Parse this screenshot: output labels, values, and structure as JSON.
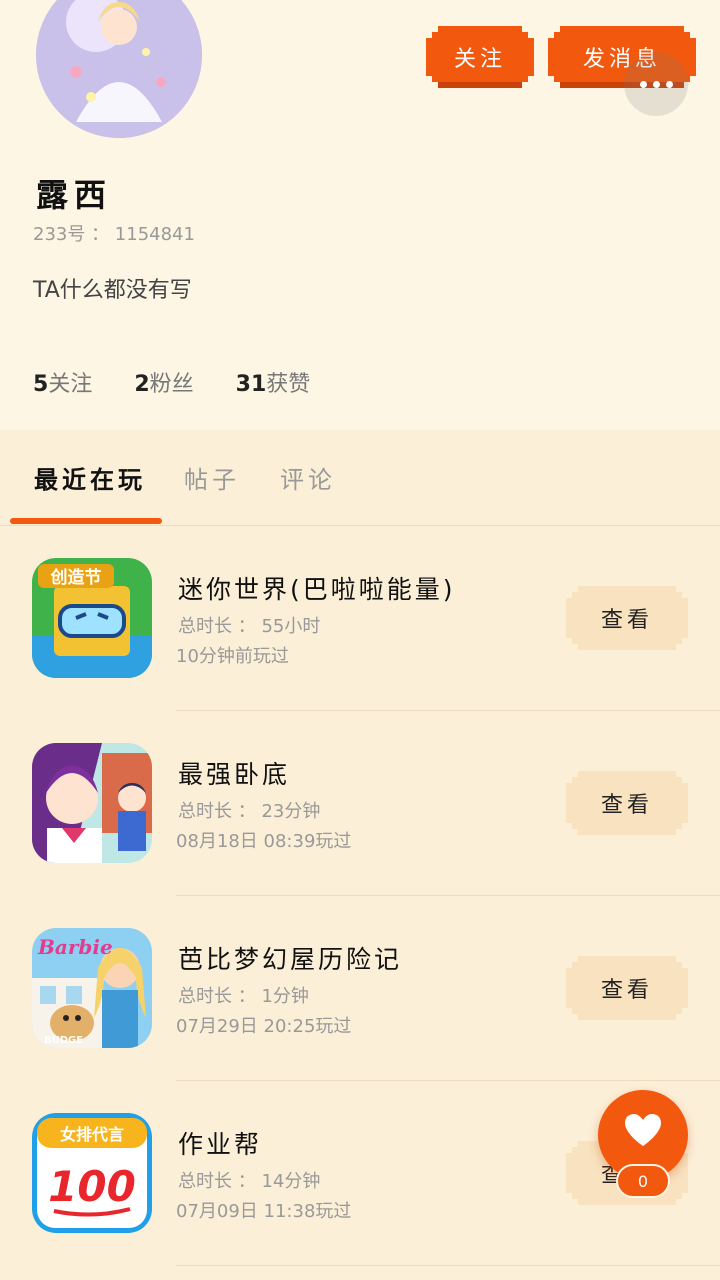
{
  "profile": {
    "username": "露西",
    "user_id": "233号 ： 1154841",
    "bio": "TA什么都没有写",
    "follow_label": "关注",
    "message_label": "发消息"
  },
  "stats": {
    "following_num": "5",
    "following_label": "关注",
    "fans_num": "2",
    "fans_label": "粉丝",
    "likes_num": "31",
    "likes_label": "获赞"
  },
  "tabs": {
    "recent": "最近在玩",
    "posts": "帖子",
    "comments": "评论"
  },
  "games": [
    {
      "title": "迷你世界(巴啦啦能量)",
      "duration": "总时长 ： 55小时",
      "last_played": "10分钟前玩过",
      "view_label": "查看"
    },
    {
      "title": "最强卧底",
      "duration": "总时长 ： 23分钟",
      "last_played": "08月18日 08:39玩过",
      "view_label": "查看"
    },
    {
      "title": "芭比梦幻屋历险记",
      "duration": "总时长 ： 1分钟",
      "last_played": "07月29日 20:25玩过",
      "view_label": "查看"
    },
    {
      "title": "作业帮",
      "duration": "总时长 ： 14分钟",
      "last_played": "07月09日 11:38玩过",
      "view_label": "查看"
    }
  ],
  "icon_text": {
    "game0": "创造节",
    "game2_brand": "Barbie",
    "game2_sub": "BUDGE",
    "game3_top": "女排代言",
    "game3_num": "100"
  },
  "fab": {
    "like_count": "0"
  },
  "colors": {
    "accent": "#f2590f",
    "background": "#fcefd8",
    "header_bg": "#fdf6e4",
    "view_button": "#f9e2c0"
  }
}
